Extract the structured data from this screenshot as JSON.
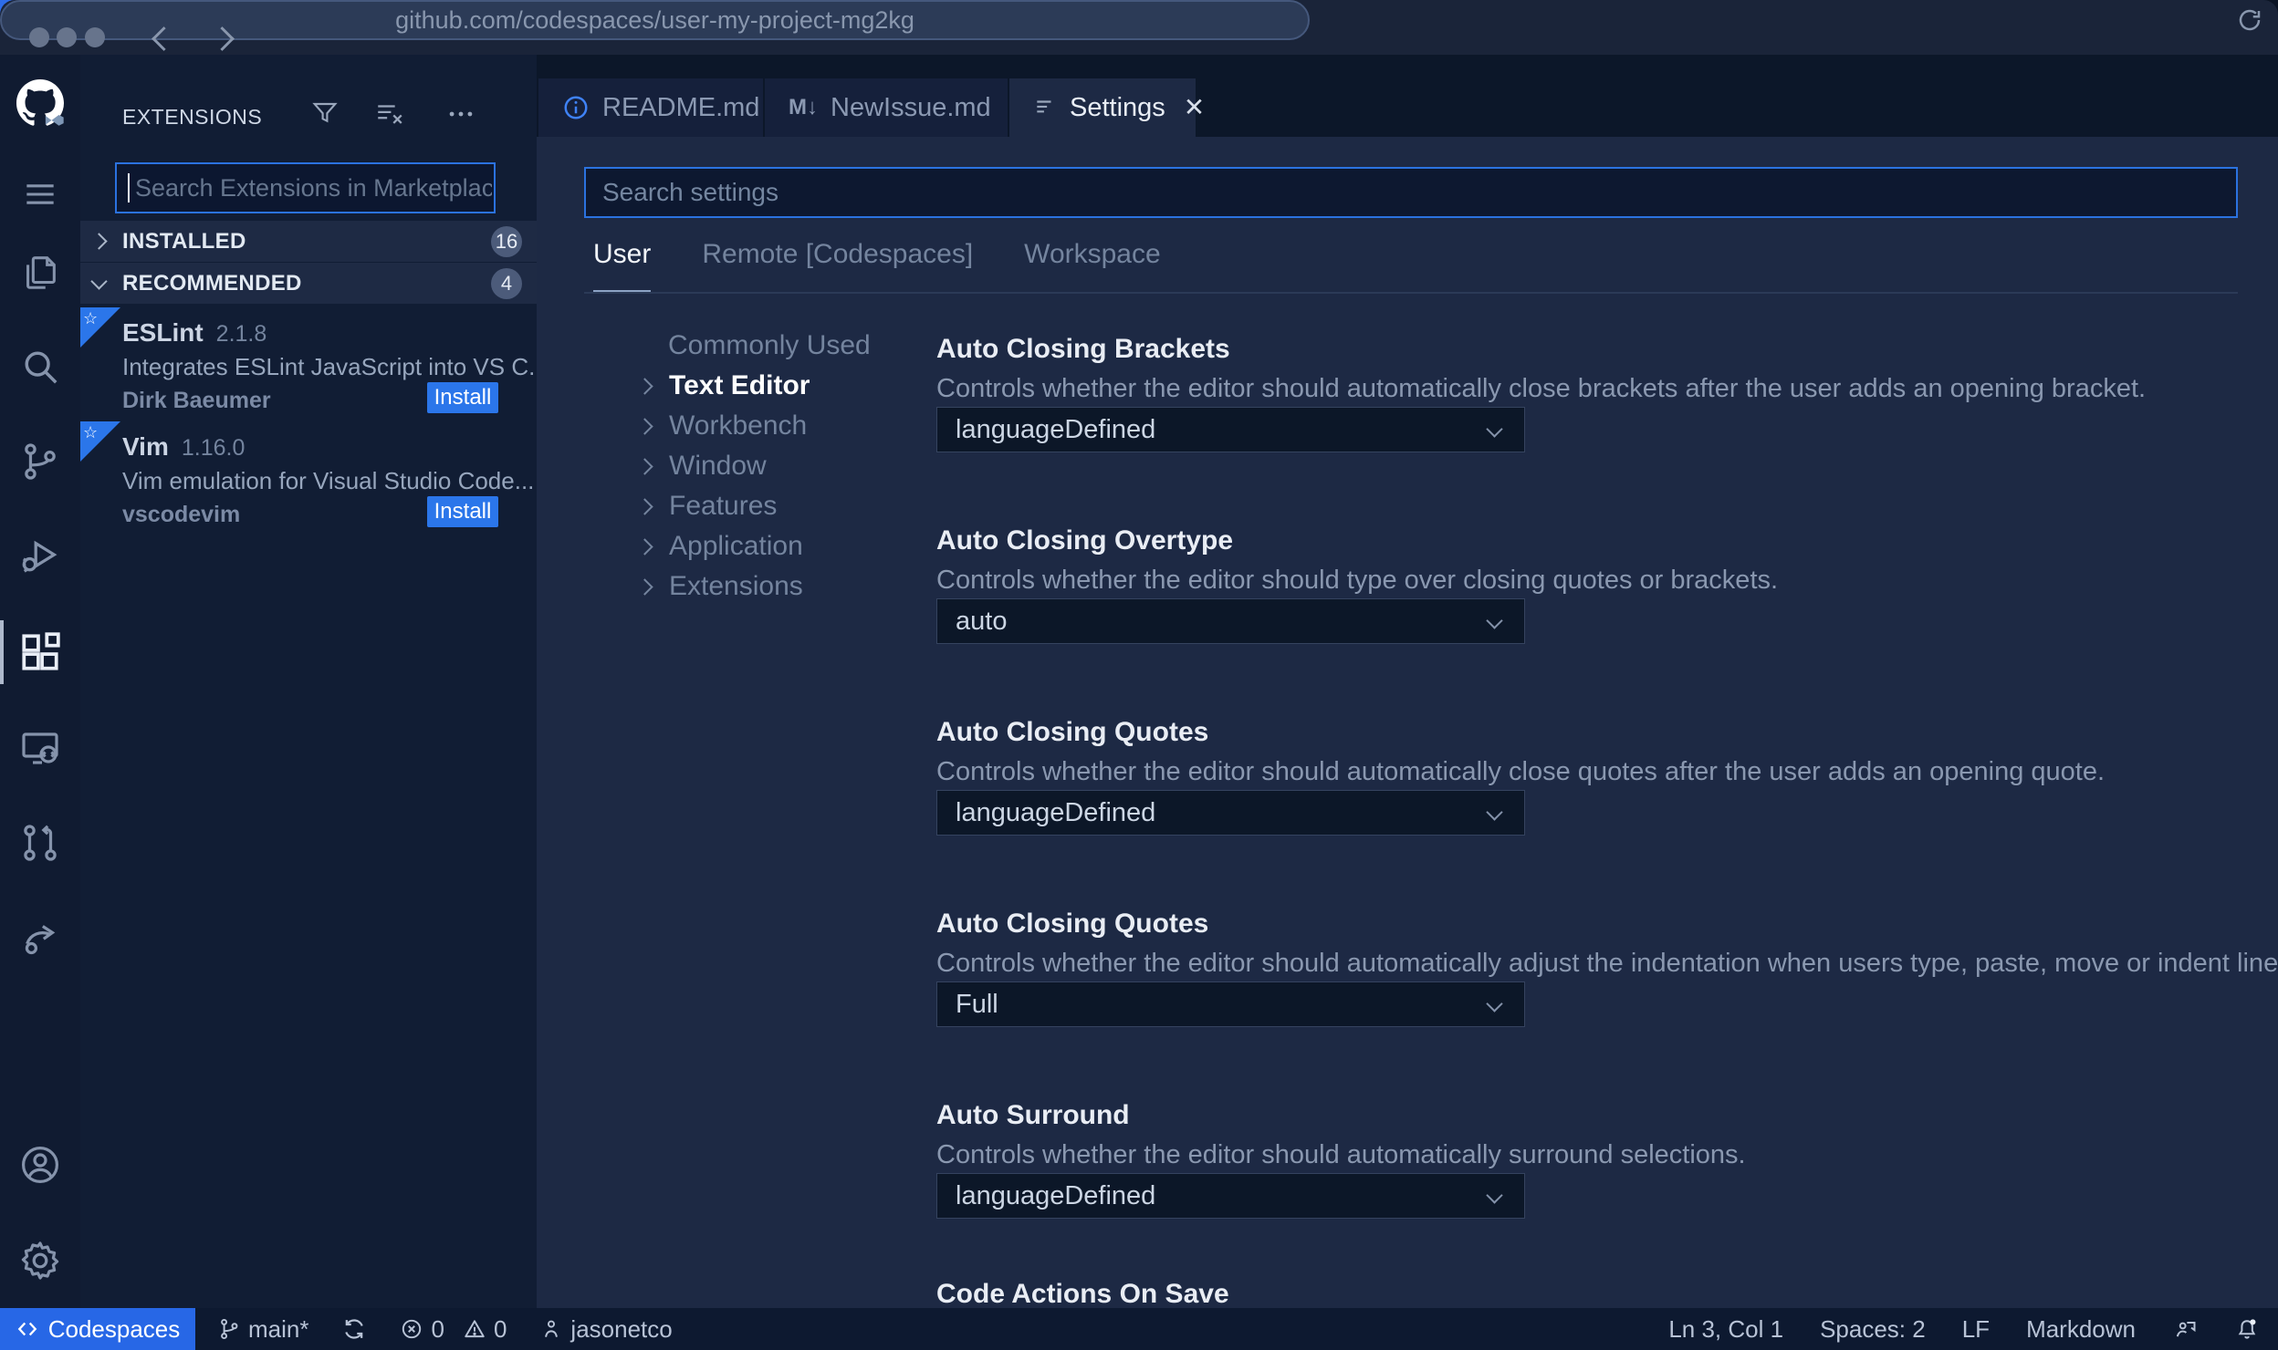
{
  "browser": {
    "url": "github.com/codespaces/user-my-project-mg2kg"
  },
  "activity_bar": {
    "icons": [
      "github-vscode-logo",
      "menu",
      "explorer",
      "search",
      "source-control",
      "run-debug",
      "extensions",
      "remote-explorer",
      "pull-requests",
      "live-share",
      "account",
      "settings-gear"
    ],
    "active_icon": "extensions"
  },
  "sidebar": {
    "title": "EXTENSIONS",
    "search_placeholder": "Search Extensions in Marketplace",
    "sections": [
      {
        "label": "INSTALLED",
        "count": "16",
        "collapsed": true
      },
      {
        "label": "RECOMMENDED",
        "count": "4",
        "collapsed": false
      }
    ],
    "extensions": [
      {
        "name": "ESLint",
        "version": "2.1.8",
        "description": "Integrates ESLint JavaScript into VS C...",
        "publisher": "Dirk Baeumer",
        "action": "Install"
      },
      {
        "name": "Vim",
        "version": "1.16.0",
        "description": "Vim emulation for Visual Studio Code...",
        "publisher": "vscodevim",
        "action": "Install"
      }
    ]
  },
  "tabs": [
    {
      "label": "README.md",
      "icon": "info-icon"
    },
    {
      "label": "NewIssue.md",
      "icon": "markdown-icon",
      "icon_text": "M↓"
    },
    {
      "label": "Settings",
      "icon": "settings-list-icon",
      "active": true,
      "closable": true
    }
  ],
  "settings": {
    "search_placeholder": "Search settings",
    "scope_tabs": [
      {
        "label": "User",
        "active": true
      },
      {
        "label": "Remote [Codespaces]",
        "active": false
      },
      {
        "label": "Workspace",
        "active": false
      }
    ],
    "toc": [
      {
        "label": "Commonly Used",
        "chevron": false,
        "active": false
      },
      {
        "label": "Text Editor",
        "chevron": true,
        "active": true
      },
      {
        "label": "Workbench",
        "chevron": true,
        "active": false
      },
      {
        "label": "Window",
        "chevron": true,
        "active": false
      },
      {
        "label": "Features",
        "chevron": true,
        "active": false
      },
      {
        "label": "Application",
        "chevron": true,
        "active": false
      },
      {
        "label": "Extensions",
        "chevron": true,
        "active": false
      }
    ],
    "items": [
      {
        "title": "Auto Closing Brackets",
        "description": "Controls whether the editor should automatically close brackets after the user adds an opening bracket.",
        "value": "languageDefined"
      },
      {
        "title": "Auto Closing Overtype",
        "description": "Controls whether the editor should type over closing quotes or brackets.",
        "value": "auto"
      },
      {
        "title": "Auto Closing Quotes",
        "description": "Controls whether the editor should automatically close quotes after the user adds an opening quote.",
        "value": "languageDefined"
      },
      {
        "title": "Auto Closing Quotes",
        "description": "Controls whether the editor should automatically adjust the indentation when users type, paste, move or indent lines.",
        "value": "Full"
      },
      {
        "title": "Auto Surround",
        "description": "Controls whether the editor should automatically surround selections.",
        "value": "languageDefined"
      },
      {
        "title": "Code Actions On Save",
        "description": "",
        "value": ""
      }
    ]
  },
  "status_bar": {
    "remote_label": "Codespaces",
    "branch": "main*",
    "errors": "0",
    "warnings": "0",
    "user": "jasonetco",
    "line_col": "Ln 3, Col 1",
    "spaces": "Spaces: 2",
    "eol": "LF",
    "language": "Markdown"
  },
  "colors": {
    "accent_blue": "#2b76ea",
    "codespaces_blue": "#2767e6",
    "editor_bg": "#1d2944",
    "sidebar_bg": "#111d34",
    "statusbar_bg": "#0d1930",
    "desktop_blue": "#2e6ce8"
  }
}
